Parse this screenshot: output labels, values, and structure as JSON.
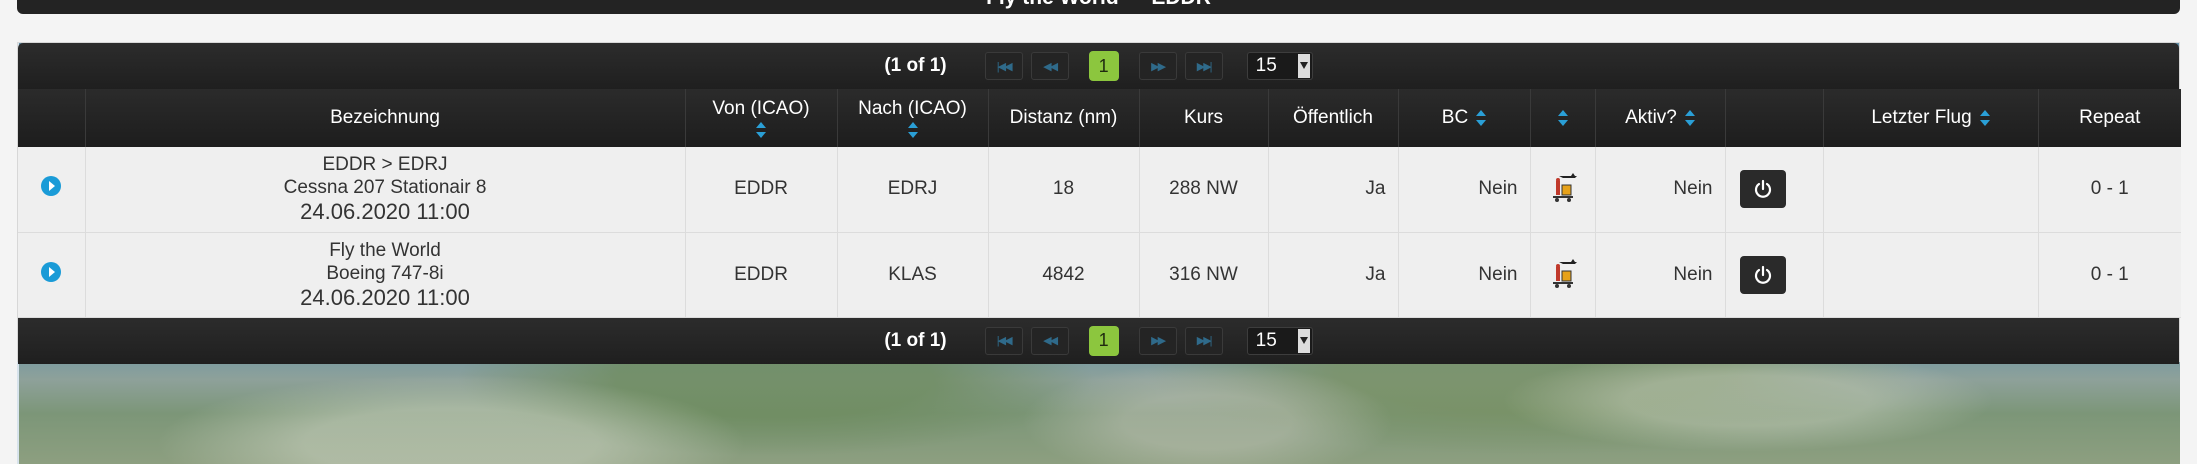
{
  "header": {
    "title": "Fly the World — EDDR"
  },
  "paginator": {
    "status": "(1 of 1)",
    "first_icon": "first-page-icon",
    "prev_icon": "prev-page-icon",
    "current_page": "1",
    "next_icon": "next-page-icon",
    "last_icon": "last-page-icon",
    "rows_per_page": "15"
  },
  "columns": {
    "expand": "",
    "bezeichnung": "Bezeichnung",
    "von": "Von (ICAO)",
    "nach": "Nach (ICAO)",
    "distanz": "Distanz (nm)",
    "kurs": "Kurs",
    "oeffentlich": "Öffentlich",
    "bc": "BC",
    "icon_col": "",
    "aktiv": "Aktiv?",
    "power": "",
    "letzter_flug": "Letzter Flug",
    "repeat": "Repeat"
  },
  "rows": [
    {
      "name_line1": "EDDR > EDRJ",
      "name_line2": "Cessna 207 Stationair 8",
      "name_line3": "24.06.2020 11:00",
      "von": "EDDR",
      "nach": "EDRJ",
      "distanz": "18",
      "kurs": "288 NW",
      "oeffentlich": "Ja",
      "bc": "Nein",
      "aktiv": "Nein",
      "letzter_flug": "",
      "repeat": "0 - 1"
    },
    {
      "name_line1": "Fly the World",
      "name_line2": "Boeing 747-8i",
      "name_line3": "24.06.2020 11:00",
      "von": "EDDR",
      "nach": "KLAS",
      "distanz": "4842",
      "kurs": "316 NW",
      "oeffentlich": "Ja",
      "bc": "Nein",
      "aktiv": "Nein",
      "letzter_flug": "",
      "repeat": "0 - 1"
    }
  ],
  "colors": {
    "accent": "#2a9fd6",
    "page_active": "#8cc63e",
    "header_bg": "#232323",
    "row_bg": "#efefef"
  }
}
